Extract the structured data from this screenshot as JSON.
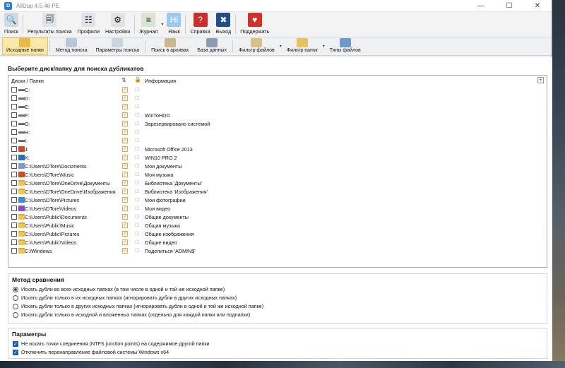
{
  "window": {
    "title": "AllDup 4.5.46 PE"
  },
  "toolbar_main": [
    {
      "label": "Поиск",
      "icon": "search-icon",
      "color": "#cfd8e4"
    },
    {
      "label": "Результаты поиска",
      "icon": "results-icon",
      "color": "#dde4ec"
    },
    {
      "label": "Профили",
      "icon": "profiles-icon",
      "color": "#dfe3e8"
    },
    {
      "label": "Настройки",
      "icon": "settings-icon",
      "color": "#e2e2e2"
    },
    {
      "label": "Журнал",
      "icon": "log-icon",
      "color": "#d8e6d0"
    },
    {
      "label": "Язык",
      "icon": "language-icon",
      "color": "#9cc8f0"
    },
    {
      "label": "Справка",
      "icon": "help-icon",
      "color": "#c8302c"
    },
    {
      "label": "Выход",
      "icon": "exit-icon",
      "color": "#1f4f86"
    },
    {
      "label": "Поддержать",
      "icon": "paypal-icon",
      "color": "#d0322a"
    }
  ],
  "toolbar_sources": [
    {
      "label": "Исходные папки",
      "icon": "source-folders-icon",
      "active": true
    },
    {
      "label": "Метод поиска",
      "icon": "search-method-icon"
    },
    {
      "label": "Параметры поиска",
      "icon": "search-params-icon"
    },
    {
      "label": "Поиск в архивах",
      "icon": "archive-icon"
    },
    {
      "label": "База данных",
      "icon": "database-icon"
    },
    {
      "label": "Фильтр файлов",
      "icon": "file-filter-icon"
    },
    {
      "label": "Фильтр папок",
      "icon": "folder-filter-icon"
    },
    {
      "label": "Типы файлов",
      "icon": "file-types-icon"
    }
  ],
  "source_section": {
    "title": "Выберите диск/папку для поиска дубликатов",
    "col_name": "Диски / Папки",
    "col_info": "Информация",
    "rows": [
      {
        "path": "C:",
        "info": "",
        "type": "drive"
      },
      {
        "path": "D:",
        "info": "",
        "type": "drive"
      },
      {
        "path": "E:",
        "info": "",
        "type": "drive"
      },
      {
        "path": "F:",
        "info": "WinToHDD",
        "type": "drive"
      },
      {
        "path": "G:",
        "info": "Зарезервировано системой",
        "type": "drive"
      },
      {
        "path": "H:",
        "info": "",
        "type": "drive"
      },
      {
        "path": "I:",
        "info": "",
        "type": "drive"
      },
      {
        "path": "J:",
        "info": "Microsoft Office 2013",
        "type": "drive"
      },
      {
        "path": "K:",
        "info": "WIN10 PRO 2",
        "type": "drive"
      },
      {
        "path": "C:\\Users\\DTore\\Documents",
        "info": "Мои документы",
        "type": "folder"
      },
      {
        "path": "C:\\Users\\DTore\\Music",
        "info": "Моя музыка",
        "type": "folder"
      },
      {
        "path": "C:\\Users\\DTore\\OneDrive\\Документы",
        "info": "Библиотека 'Документы'",
        "type": "folder"
      },
      {
        "path": "C:\\Users\\DTore\\OneDrive\\Изображения",
        "info": "Библиотека 'Изображения'",
        "type": "folder"
      },
      {
        "path": "C:\\Users\\DTore\\Pictures",
        "info": "Мои фотографии",
        "type": "folder"
      },
      {
        "path": "C:\\Users\\DTore\\Videos",
        "info": "Мои видео",
        "type": "folder"
      },
      {
        "path": "C:\\Users\\Public\\Documents",
        "info": "Общие документы",
        "type": "folder"
      },
      {
        "path": "C:\\Users\\Public\\Music",
        "info": "Общая музыка",
        "type": "folder"
      },
      {
        "path": "C:\\Users\\Public\\Pictures",
        "info": "Общие изображения",
        "type": "folder"
      },
      {
        "path": "C:\\Users\\Public\\Videos",
        "info": "Общие видео",
        "type": "folder"
      },
      {
        "path": "C:\\Windows",
        "info": "Поделиться 'ADMIN$'",
        "type": "folder"
      }
    ]
  },
  "compare_method": {
    "title": "Метод сравнения",
    "options": [
      {
        "label": "Искать дубли во всех исходных папках (в том числе в одной и той же исходной папке)",
        "selected": true
      },
      {
        "label": "Искать дубли только в их исходных папках (игнорировать дубли в других исходных папках)",
        "selected": false
      },
      {
        "label": "Искать дубли только в других исходных папках (игнорировать дубли в одной и той же исходной папке)",
        "selected": false
      },
      {
        "label": "Искать дубли только в исходной и вложенных папках (отдельно для каждой папки или подпапки)",
        "selected": false
      }
    ]
  },
  "params": {
    "title": "Параметры",
    "options": [
      {
        "label": "Не искать точки соединения (NTFS junction points) на содержимое другой папки",
        "checked": true
      },
      {
        "label": "Отключить перенаправление файловой системы Windows x64",
        "checked": true
      }
    ]
  }
}
